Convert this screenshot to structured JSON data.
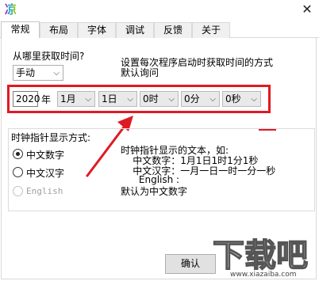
{
  "window": {
    "app_icon_char": "凉",
    "close_glyph": "✕"
  },
  "tabs": [
    "常规",
    "布局",
    "字体",
    "调试",
    "反馈",
    "关于"
  ],
  "general": {
    "source_label": "从哪里获取时间?",
    "source_value": "手动",
    "source_hint_line1": "设置每次程序启动时获取时间的方式",
    "source_hint_line2": "默认询问",
    "year_value": "2020",
    "year_suffix": "年",
    "month_value": "1月",
    "day_value": "1日",
    "hour_value": "0时",
    "minute_value": "0分",
    "second_value": "0秒"
  },
  "clock_format": {
    "title": "时钟指针显示方式:",
    "options": [
      "中文数字",
      "中文汉字",
      "English"
    ],
    "selected_index": 0,
    "desc_lines": [
      "时钟指针显示的文本，如:",
      "    中文数字：1月1日1时1分1秒",
      "    中文汉字：一月一日一时一分一秒",
      "      English :",
      "默认为中文数字"
    ]
  },
  "buttons": {
    "ok": "确认"
  },
  "watermark": {
    "text": "下载吧",
    "url": "www.xiazaiba.com"
  },
  "colors": {
    "annotation_red": "#e01a22"
  }
}
